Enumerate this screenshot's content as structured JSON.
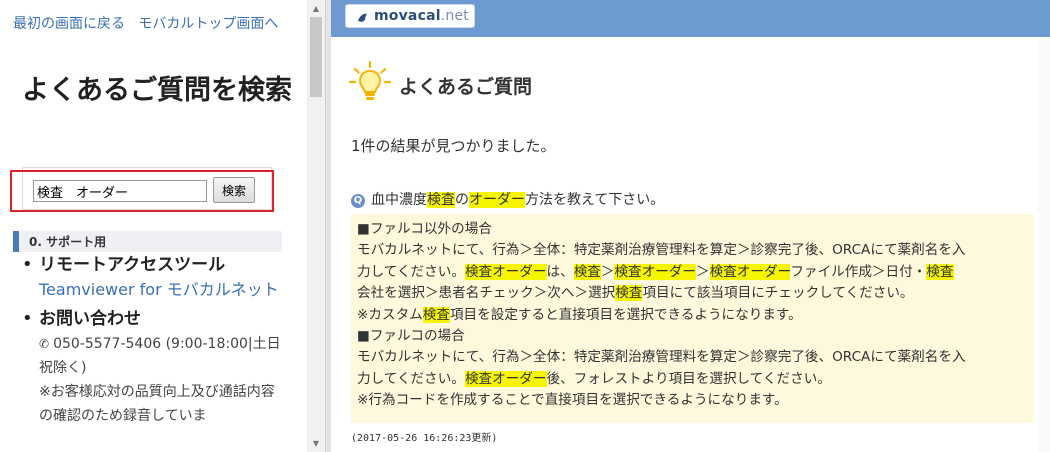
{
  "left": {
    "links": [
      "最初の画面に戻る",
      "モバカルトップ画面へ"
    ],
    "title": "よくあるご質問を検索",
    "search": {
      "value": "検査　オーダー",
      "button": "検索"
    },
    "category": "0. サポート用",
    "items": [
      {
        "title": "リモートアクセスツール",
        "link": "Teamviewer for モバカルネット"
      },
      {
        "title": "お問い合わせ",
        "phone": "050-5577-5406 (9:00-18:00|土日祝除く)",
        "note": "※お客様応対の品質向上及び通話内容の確認のため録音していま"
      }
    ]
  },
  "brand": {
    "name": "movacal",
    "tld": ".net"
  },
  "main": {
    "title": "よくあるご質問",
    "result_count": "1件の結果が見つかりました。",
    "question": {
      "parts": [
        "血中濃度",
        "検査",
        "の",
        "オーダー",
        "方法を教えて下さい。"
      ]
    },
    "answer": {
      "l1": "■ファルコ以外の場合",
      "l2": "モバカルネットにて、行為＞全体：特定薬剤治療管理料を算定＞診察完了後、ORCAにて薬剤名を入",
      "l3": [
        "力してください。",
        "検査オーダー",
        "は、",
        "検査",
        "＞",
        "検査オーダー",
        "＞",
        "検査オーダー",
        "ファイル作成＞日付・",
        "検査"
      ],
      "l4": [
        "会社を選択＞患者名チェック＞次へ＞選択",
        "検査",
        "項目にて該当項目にチェックしてください。"
      ],
      "l5": [
        "※カスタム",
        "検査",
        "項目を設定すると直接項目を選択できるようになります。"
      ],
      "l6": "■ファルコの場合",
      "l7": "モバカルネットにて、行為＞全体：特定薬剤治療管理料を算定＞診察完了後、ORCAにて薬剤名を入",
      "l8": [
        "力してください。",
        "検査オーダー",
        "後、フォレストより項目を選択してください。"
      ],
      "l9": "※行為コードを作成することで直接項目を選択できるようになります。"
    },
    "timestamp": "(2017-05-26 16:26:23更新)"
  },
  "colors": {
    "topbar": "#6c9ad1",
    "highlight": "#f5f500",
    "answer_bg": "#fef9dc",
    "link": "#3a6fb5",
    "red_box": "#e0202b"
  },
  "icons": [
    "phone-icon",
    "lightbulb-icon",
    "question-icon",
    "bird-logo-icon"
  ]
}
